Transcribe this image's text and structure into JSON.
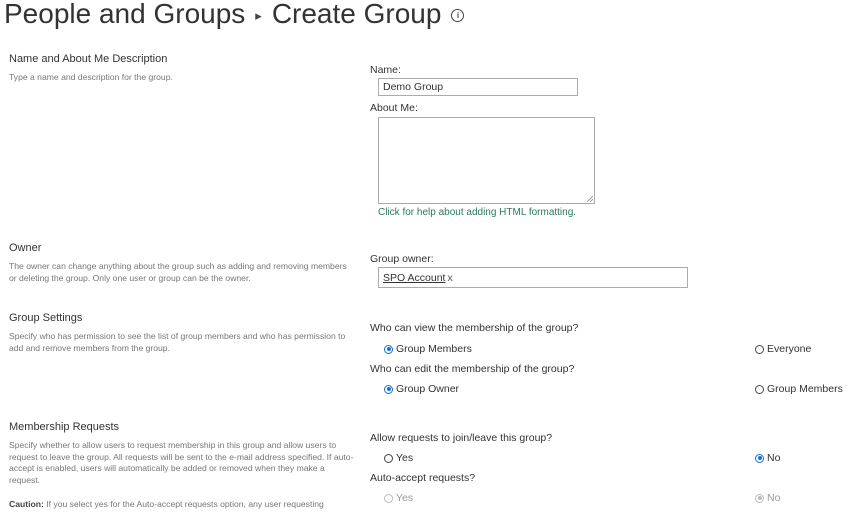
{
  "header": {
    "breadcrumb_parent": "People and Groups",
    "separator": "▸",
    "page_title": "Create Group",
    "info_glyph": "i"
  },
  "sections": {
    "name": {
      "title": "Name and About Me Description",
      "description": "Type a name and description for the group.",
      "name_label": "Name:",
      "name_value": "Demo Group",
      "about_label": "About Me:",
      "about_value": "",
      "help_link": "Click for help about adding HTML formatting."
    },
    "owner": {
      "title": "Owner",
      "description": "The owner can change anything about the group such as adding and removing members or deleting the group. Only one user or group can be the owner.",
      "owner_label": "Group owner:",
      "owner_value": "SPO Account",
      "owner_remove": "x"
    },
    "settings": {
      "title": "Group Settings",
      "description": "Specify who has permission to see the list of group members and who has permission to add and remove members from the group.",
      "view_question": "Who can view the membership of the group?",
      "view_options": [
        "Group Members",
        "Everyone"
      ],
      "view_selected": "Group Members",
      "edit_question": "Who can edit the membership of the group?",
      "edit_options": [
        "Group Owner",
        "Group Members"
      ],
      "edit_selected": "Group Owner"
    },
    "membership": {
      "title": "Membership Requests",
      "description": "Specify whether to allow users to request membership in this group and allow users to request to leave the group. All requests will be sent to the e-mail address specified. If auto-accept is enabled, users will automatically be added or removed when they make a request.",
      "caution_label": "Caution:",
      "caution_text": " If you select yes for the Auto-accept requests option, any user requesting",
      "allow_question": "Allow requests to join/leave this group?",
      "allow_options": [
        "Yes",
        "No"
      ],
      "allow_selected": "No",
      "auto_question": "Auto-accept requests?",
      "auto_options": [
        "Yes",
        "No"
      ],
      "auto_selected": "No"
    }
  },
  "colors": {
    "accent": "#1a6fd0",
    "link": "#2a7a5e",
    "description_text": "#777777"
  }
}
